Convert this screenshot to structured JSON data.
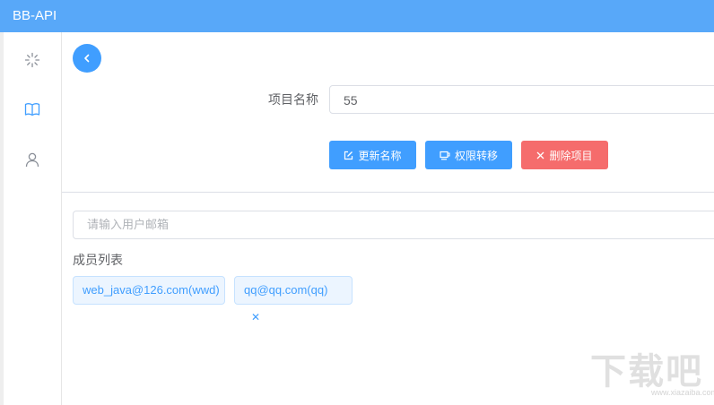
{
  "app": {
    "title": "BB-API"
  },
  "sidebar": {
    "items": [
      {
        "icon": "loading-icon"
      },
      {
        "icon": "book-icon"
      },
      {
        "icon": "user-icon"
      }
    ]
  },
  "project_form": {
    "name_label": "项目名称",
    "name_value": "55"
  },
  "actions": {
    "update_label": "更新名称",
    "transfer_label": "权限转移",
    "delete_label": "删除项目"
  },
  "members": {
    "email_placeholder": "请输入用户邮箱",
    "title": "成员列表",
    "tags": [
      {
        "label": "web_java@126.com(wwd)"
      },
      {
        "label": "qq@qq.com(qq)",
        "closable": true
      }
    ]
  },
  "watermark": {
    "text": "下载吧",
    "sub": "www.xiazaiba.com"
  },
  "colors": {
    "topbar": "#58a8f9",
    "primary": "#409eff",
    "danger": "#f56c6c"
  }
}
